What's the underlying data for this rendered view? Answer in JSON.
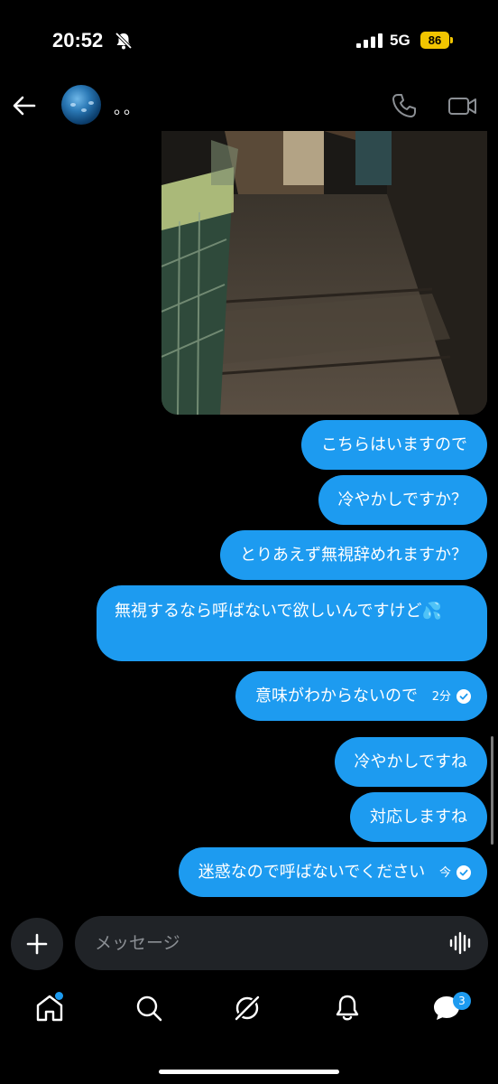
{
  "status_bar": {
    "time": "20:52",
    "network": "5G",
    "battery": "86",
    "icons": [
      "bell-muted-icon",
      "signal-icon",
      "battery-charging-icon"
    ]
  },
  "header": {
    "contact_name": "。。",
    "icons": [
      "back-arrow-icon",
      "phone-icon",
      "video-camera-icon"
    ]
  },
  "colors": {
    "bubble": "#1d9bf0",
    "background": "#000000",
    "input_bg": "#202327",
    "battery": "#f2c500"
  },
  "messages": [
    {
      "text": "こちらはいますので"
    },
    {
      "text": "冷やかしですか？"
    },
    {
      "text": "とりあえず無視辞めれますか？"
    },
    {
      "text": "無視するなら呼ばないで欲しいんですけど💦"
    },
    {
      "text": "意味がわからないので",
      "time": "2分"
    },
    {
      "text": "冷やかしですね"
    },
    {
      "text": "対応しますね"
    },
    {
      "text": "迷惑なので呼ばないでください",
      "time": "今"
    }
  ],
  "composer": {
    "placeholder": "メッセージ",
    "icons": [
      "plus-icon",
      "voice-waveform-icon"
    ]
  },
  "bottom_nav": {
    "items": [
      "home-icon",
      "search-icon",
      "grok-icon",
      "notifications-icon",
      "messages-icon"
    ],
    "messages_badge": "3"
  }
}
